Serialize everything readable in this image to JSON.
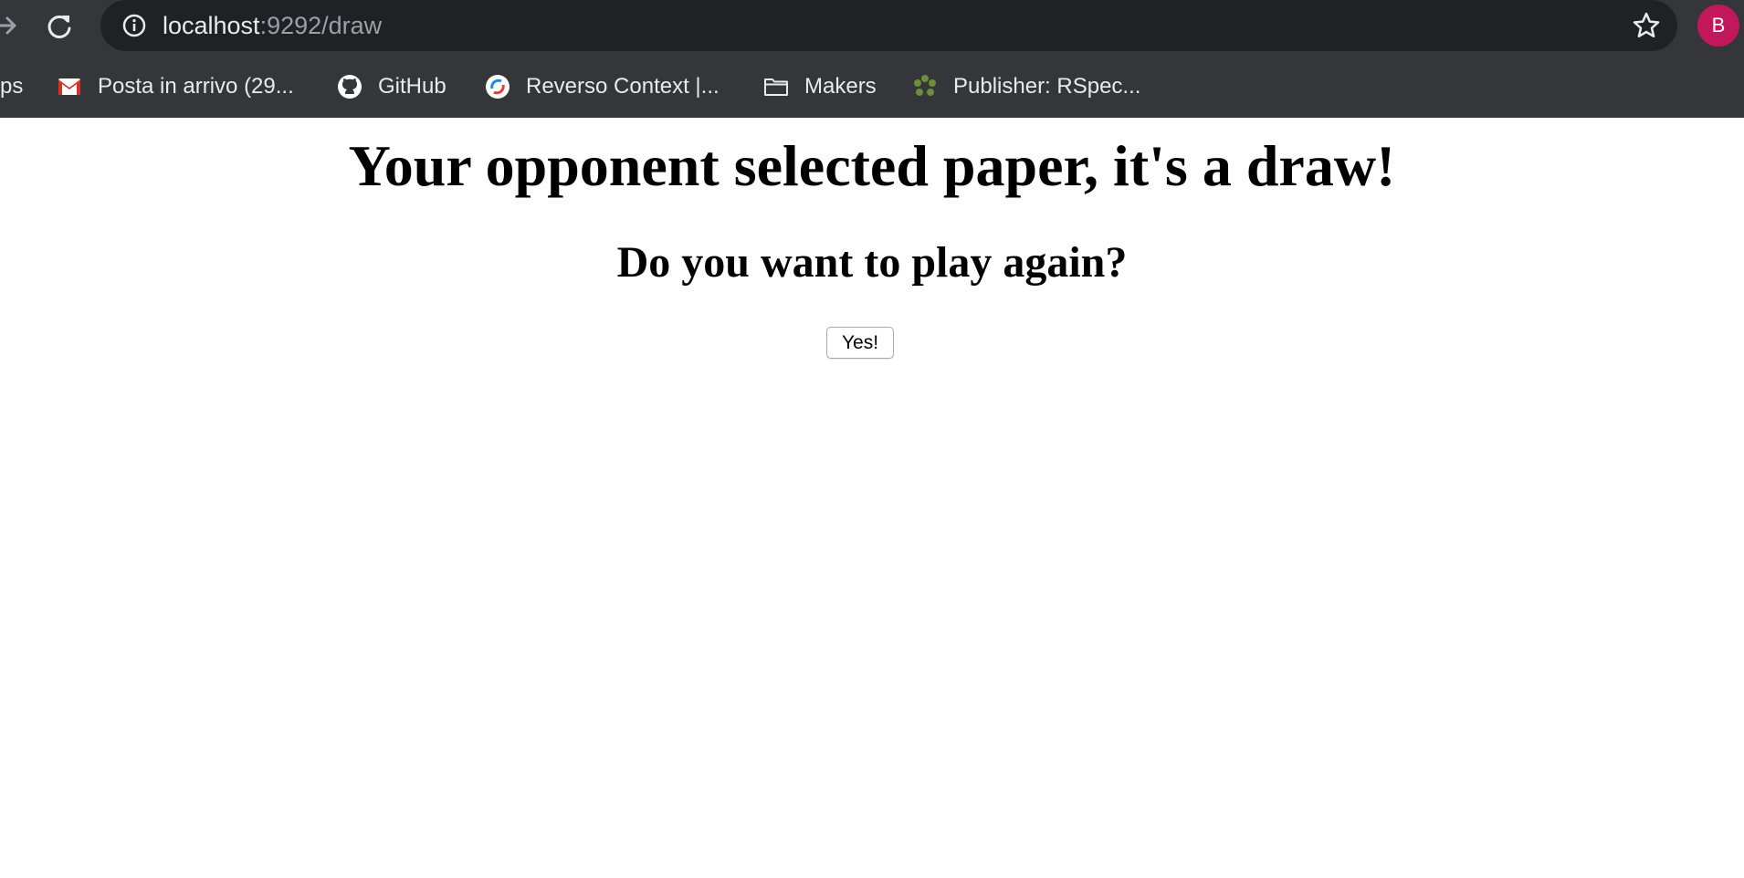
{
  "browser": {
    "url_host": "localhost",
    "url_rest": ":9292/draw",
    "profile_initial": "B",
    "profile_color": "#c2185b",
    "bookmarks": [
      {
        "label": "ps",
        "icon": "apps-icon"
      },
      {
        "label": "Posta in arrivo (29...",
        "icon": "gmail-icon"
      },
      {
        "label": "GitHub",
        "icon": "github-icon"
      },
      {
        "label": "Reverso Context |...",
        "icon": "reverso-icon"
      },
      {
        "label": "Makers",
        "icon": "folder-icon"
      },
      {
        "label": "Publisher: RSpec...",
        "icon": "publisher-icon"
      }
    ]
  },
  "page": {
    "heading": "Your opponent selected paper, it's a draw!",
    "subheading": "Do you want to play again?",
    "button_label": "Yes!"
  }
}
